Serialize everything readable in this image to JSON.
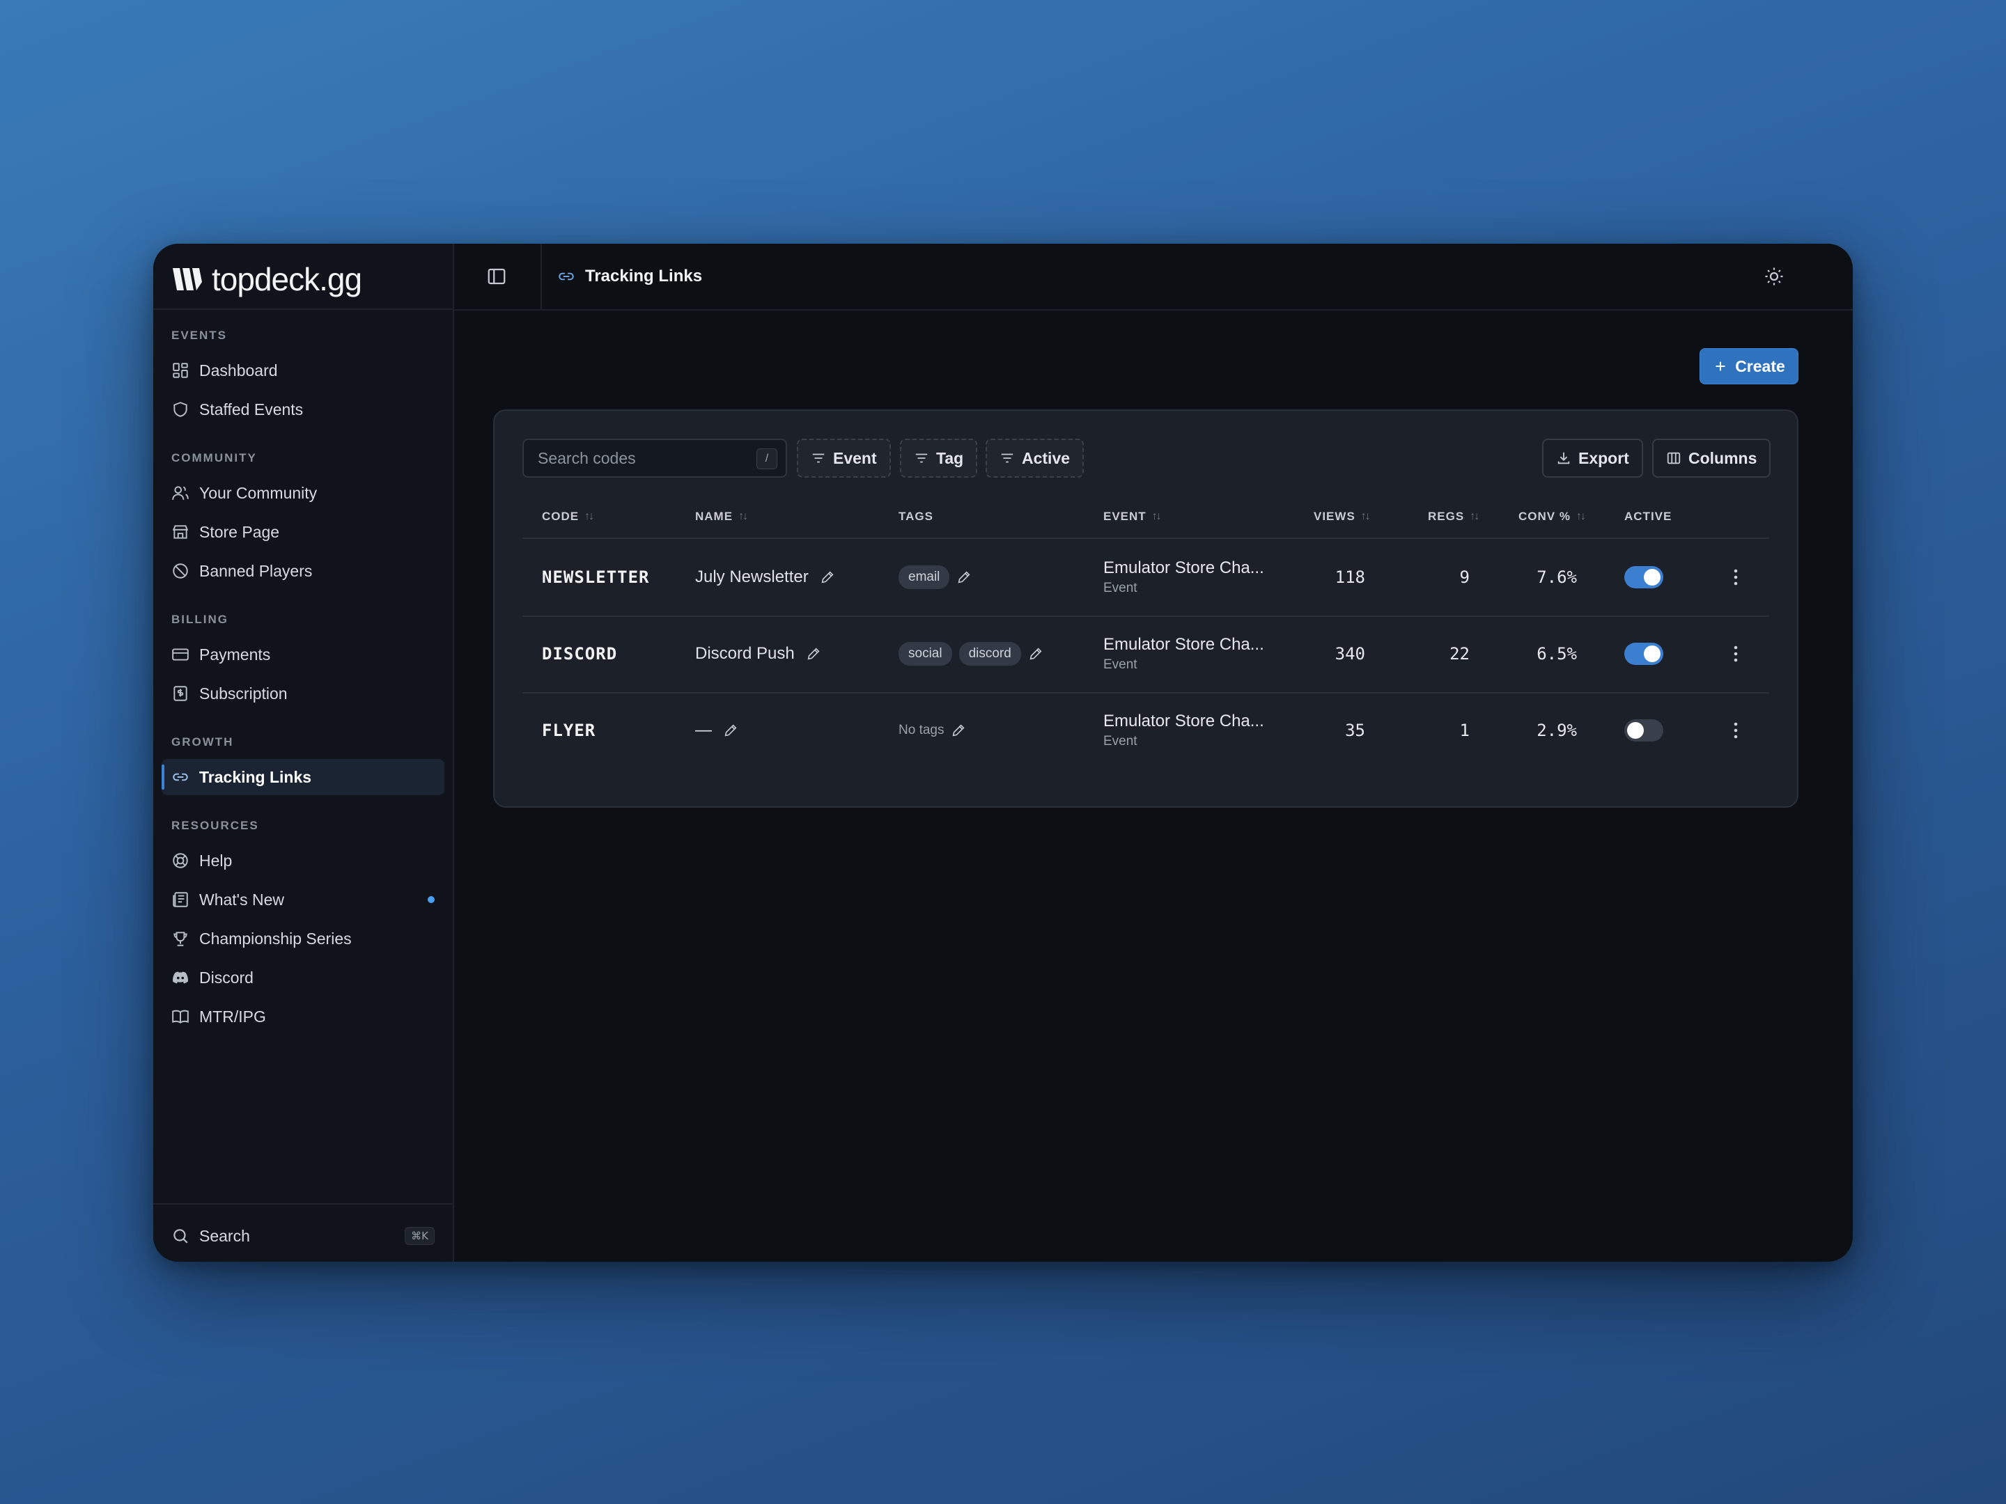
{
  "brand": {
    "name": "topdeck.gg"
  },
  "sidebar": {
    "sections": [
      {
        "title": "EVENTS",
        "items": [
          {
            "label": "Dashboard",
            "icon": "dashboard-icon"
          },
          {
            "label": "Staffed Events",
            "icon": "shield-icon"
          }
        ]
      },
      {
        "title": "COMMUNITY",
        "items": [
          {
            "label": "Your Community",
            "icon": "users-icon"
          },
          {
            "label": "Store Page",
            "icon": "store-icon"
          },
          {
            "label": "Banned Players",
            "icon": "ban-icon"
          }
        ]
      },
      {
        "title": "BILLING",
        "items": [
          {
            "label": "Payments",
            "icon": "credit-card-icon"
          },
          {
            "label": "Subscription",
            "icon": "receipt-icon"
          }
        ]
      },
      {
        "title": "GROWTH",
        "items": [
          {
            "label": "Tracking Links",
            "icon": "link-icon",
            "active": true
          }
        ]
      },
      {
        "title": "RESOURCES",
        "items": [
          {
            "label": "Help",
            "icon": "lifebuoy-icon"
          },
          {
            "label": "What's New",
            "icon": "newspaper-icon",
            "badge_dot": true
          },
          {
            "label": "Championship Series",
            "icon": "trophy-icon"
          },
          {
            "label": "Discord",
            "icon": "discord-icon"
          },
          {
            "label": "MTR/IPG",
            "icon": "book-icon"
          }
        ]
      }
    ],
    "search": {
      "label": "Search",
      "shortcut": "⌘K"
    }
  },
  "header": {
    "title": "Tracking Links"
  },
  "actions": {
    "create_label": "Create"
  },
  "toolbar": {
    "search_placeholder": "Search codes",
    "search_shortcut": "/",
    "filters": [
      "Event",
      "Tag",
      "Active"
    ],
    "export_label": "Export",
    "columns_label": "Columns"
  },
  "table": {
    "columns": [
      "CODE",
      "NAME",
      "TAGS",
      "EVENT",
      "VIEWS",
      "REGS",
      "CONV %",
      "ACTIVE"
    ],
    "rows": [
      {
        "code": "NEWSLETTER",
        "name": "July Newsletter",
        "tags": [
          "email"
        ],
        "event": "Emulator Store Cha...",
        "event_sub": "Event",
        "views": "118",
        "regs": "9",
        "conv": "7.6%",
        "active": true
      },
      {
        "code": "DISCORD",
        "name": "Discord Push",
        "tags": [
          "social",
          "discord"
        ],
        "event": "Emulator Store Cha...",
        "event_sub": "Event",
        "views": "340",
        "regs": "22",
        "conv": "6.5%",
        "active": true
      },
      {
        "code": "FLYER",
        "name": "—",
        "tags": [],
        "no_tags_label": "No tags",
        "event": "Emulator Store Cha...",
        "event_sub": "Event",
        "views": "35",
        "regs": "1",
        "conv": "2.9%",
        "active": false
      }
    ]
  },
  "colors": {
    "accent": "#2f73bf",
    "background": "#0c0f14",
    "sidebar": "#10141a",
    "card": "#1c2029"
  }
}
